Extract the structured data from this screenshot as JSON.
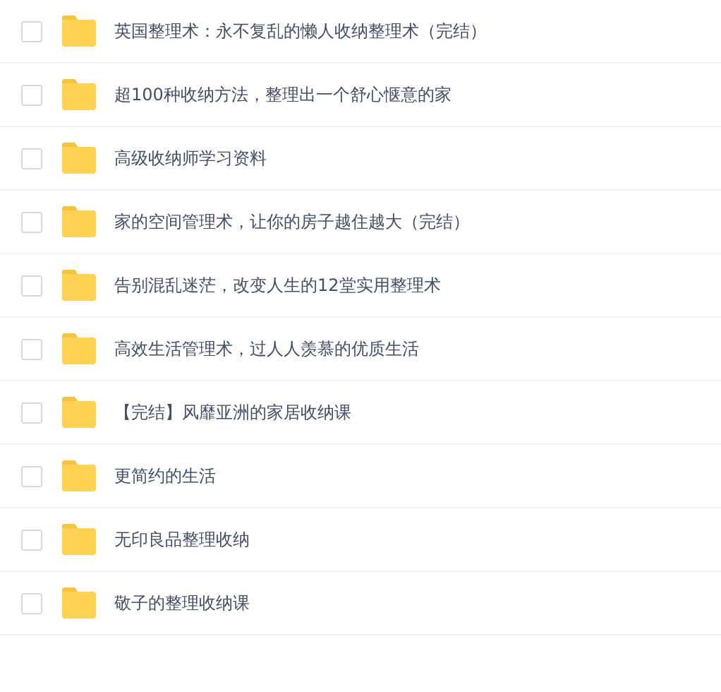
{
  "files": [
    {
      "name": "英国整理术：永不复乱的懒人收纳整理术（完结）",
      "checked": false
    },
    {
      "name": "超100种收纳方法，整理出一个舒心惬意的家",
      "checked": false
    },
    {
      "name": "高级收纳师学习资料",
      "checked": false
    },
    {
      "name": "家的空间管理术，让你的房子越住越大（完结）",
      "checked": false
    },
    {
      "name": "告别混乱迷茫，改变人生的12堂实用整理术",
      "checked": false
    },
    {
      "name": "高效生活管理术，过人人羡慕的优质生活",
      "checked": false
    },
    {
      "name": "【完结】风靡亚洲的家居收纳课",
      "checked": false
    },
    {
      "name": "更简约的生活",
      "checked": false
    },
    {
      "name": "无印良品整理收纳",
      "checked": false
    },
    {
      "name": "敬子的整理收纳课",
      "checked": false
    }
  ]
}
